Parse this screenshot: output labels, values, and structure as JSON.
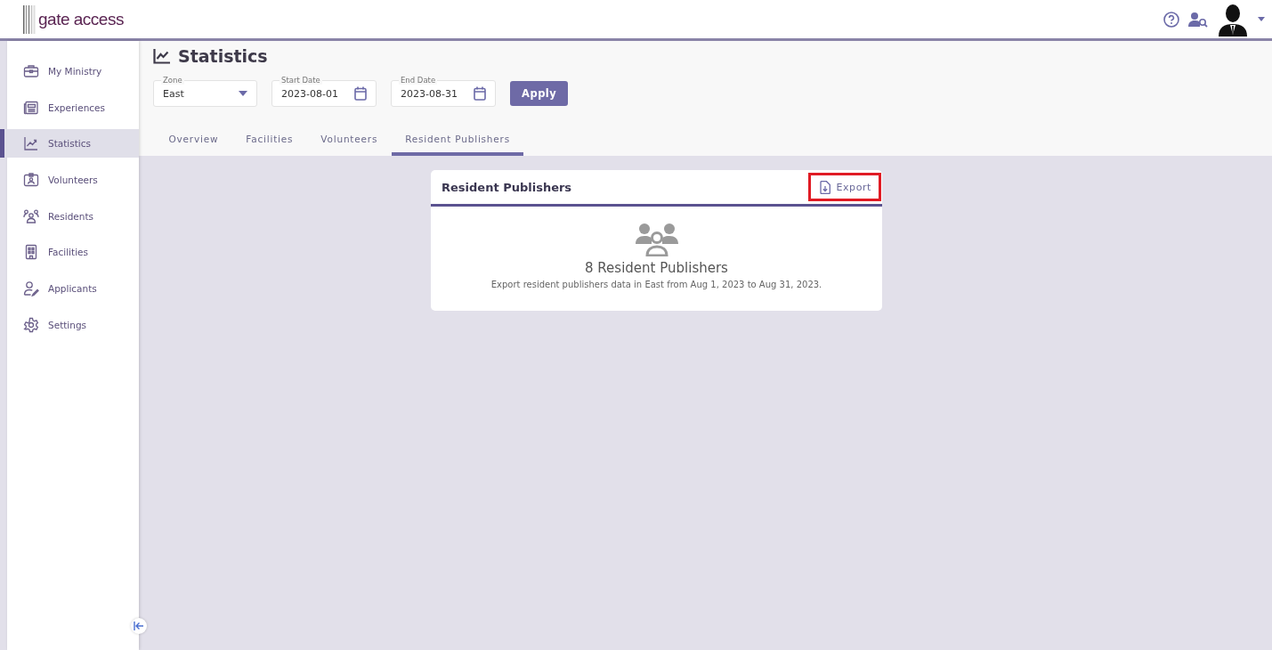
{
  "header": {
    "logo": "gate access"
  },
  "sidebar": {
    "items": [
      {
        "label": "My Ministry",
        "kind": "briefcase",
        "selected": false
      },
      {
        "label": "Experiences",
        "kind": "newspaper",
        "selected": false
      },
      {
        "label": "Statistics",
        "kind": "chart",
        "selected": true
      },
      {
        "label": "Volunteers",
        "kind": "badge",
        "selected": false
      },
      {
        "label": "Residents",
        "kind": "group",
        "selected": false
      },
      {
        "label": "Facilities",
        "kind": "building",
        "selected": false
      },
      {
        "label": "Applicants",
        "kind": "applicant",
        "selected": false
      },
      {
        "label": "Settings",
        "kind": "gear",
        "selected": false
      }
    ]
  },
  "page": {
    "title": "Statistics"
  },
  "filters": {
    "zone": {
      "label": "Zone",
      "value": "East"
    },
    "start_date": {
      "label": "Start Date",
      "value": "2023-08-01"
    },
    "end_date": {
      "label": "End Date",
      "value": "2023-08-31"
    },
    "apply": "Apply"
  },
  "tabs": [
    {
      "label": "Overview",
      "selected": false
    },
    {
      "label": "Facilities",
      "selected": false
    },
    {
      "label": "Volunteers",
      "selected": false
    },
    {
      "label": "Resident Publishers",
      "selected": true
    }
  ],
  "card": {
    "title": "Resident Publishers",
    "export": {
      "label": "Export",
      "highlighted": true
    },
    "count": "8 Resident Publishers",
    "description": "Export resident publishers data in East from Aug 1, 2023 to Aug 31, 2023."
  }
}
